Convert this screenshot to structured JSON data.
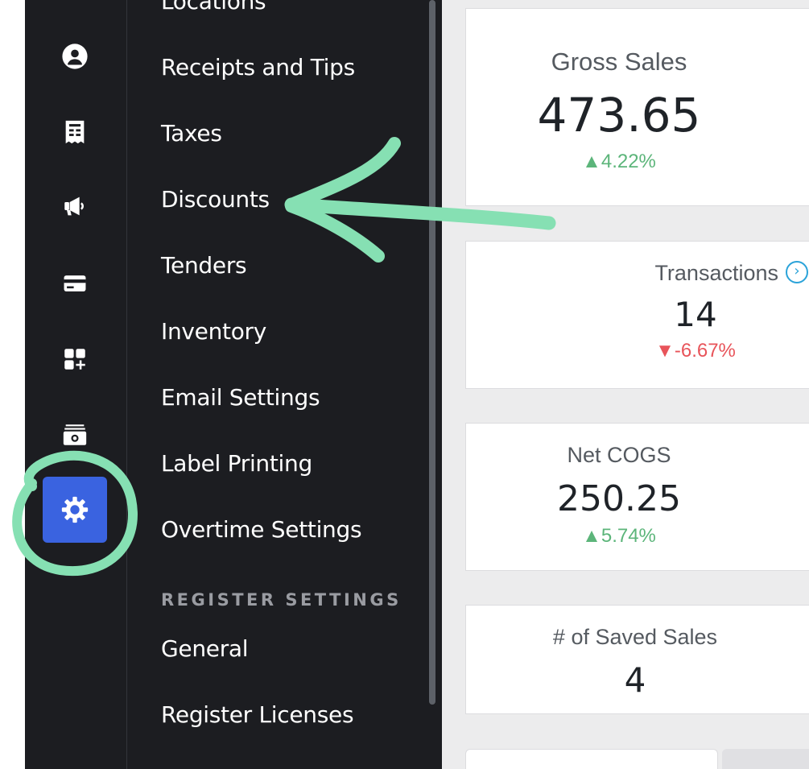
{
  "sidebar": {
    "items": [
      {
        "icon": "user-circle-icon"
      },
      {
        "icon": "receipt-icon"
      },
      {
        "icon": "megaphone-icon"
      },
      {
        "icon": "credit-card-icon"
      },
      {
        "icon": "add-apps-icon"
      },
      {
        "icon": "cash-icon"
      },
      {
        "icon": "gear-icon",
        "active": true
      }
    ]
  },
  "menu": {
    "items": [
      "Locations",
      "Receipts and Tips",
      "Taxes",
      "Discounts",
      "Tenders",
      "Inventory",
      "Email Settings",
      "Label Printing",
      "Overtime Settings"
    ],
    "section_header": "REGISTER SETTINGS",
    "register_items": [
      "General",
      "Register Licenses"
    ]
  },
  "cards": {
    "gross_sales": {
      "title": "Gross Sales",
      "value": "473.65",
      "change": "▲4.22%"
    },
    "transactions": {
      "title": "Transactions",
      "value": "14",
      "change": "▼-6.67%"
    },
    "net_cogs": {
      "title": "Net COGS",
      "value": "250.25",
      "change": "▲5.74%"
    },
    "saved_sales": {
      "title": "# of Saved Sales",
      "value": "4"
    }
  },
  "colors": {
    "sidebar_bg": "#1c1d21",
    "active_accent": "#3a63e0",
    "positive": "#5cb57a",
    "negative": "#e8545a",
    "annotation": "#86e0b3"
  }
}
